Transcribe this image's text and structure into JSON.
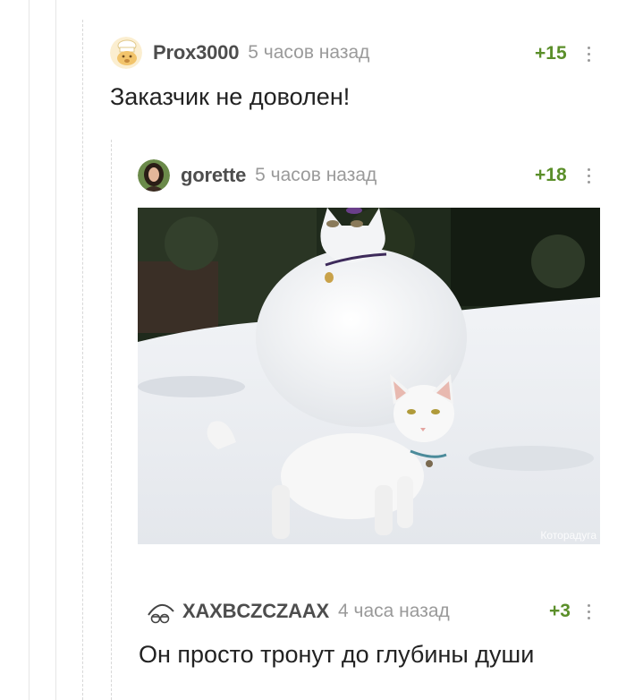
{
  "comments": [
    {
      "author": "Prox3000",
      "time": "5 часов назад",
      "rating": "+15",
      "text": "Заказчик не доволен!",
      "avatar_icon": "bear-chef-avatar"
    },
    {
      "author": "gorette",
      "time": "5 часов назад",
      "rating": "+18",
      "image": "cat-and-snow-cat-photo",
      "watermark": "Которадуга",
      "avatar_icon": "woman-portrait-avatar"
    },
    {
      "author": "XAXBCZCZAAX",
      "time": "4 часа назад",
      "rating": "+3",
      "text": "Он просто тронут до глубины души",
      "avatar_icon": "sleepy-face-avatar"
    }
  ],
  "colors": {
    "rating": "#5b8f2a",
    "author": "#4d4d4d",
    "time": "#9a9a9a"
  }
}
